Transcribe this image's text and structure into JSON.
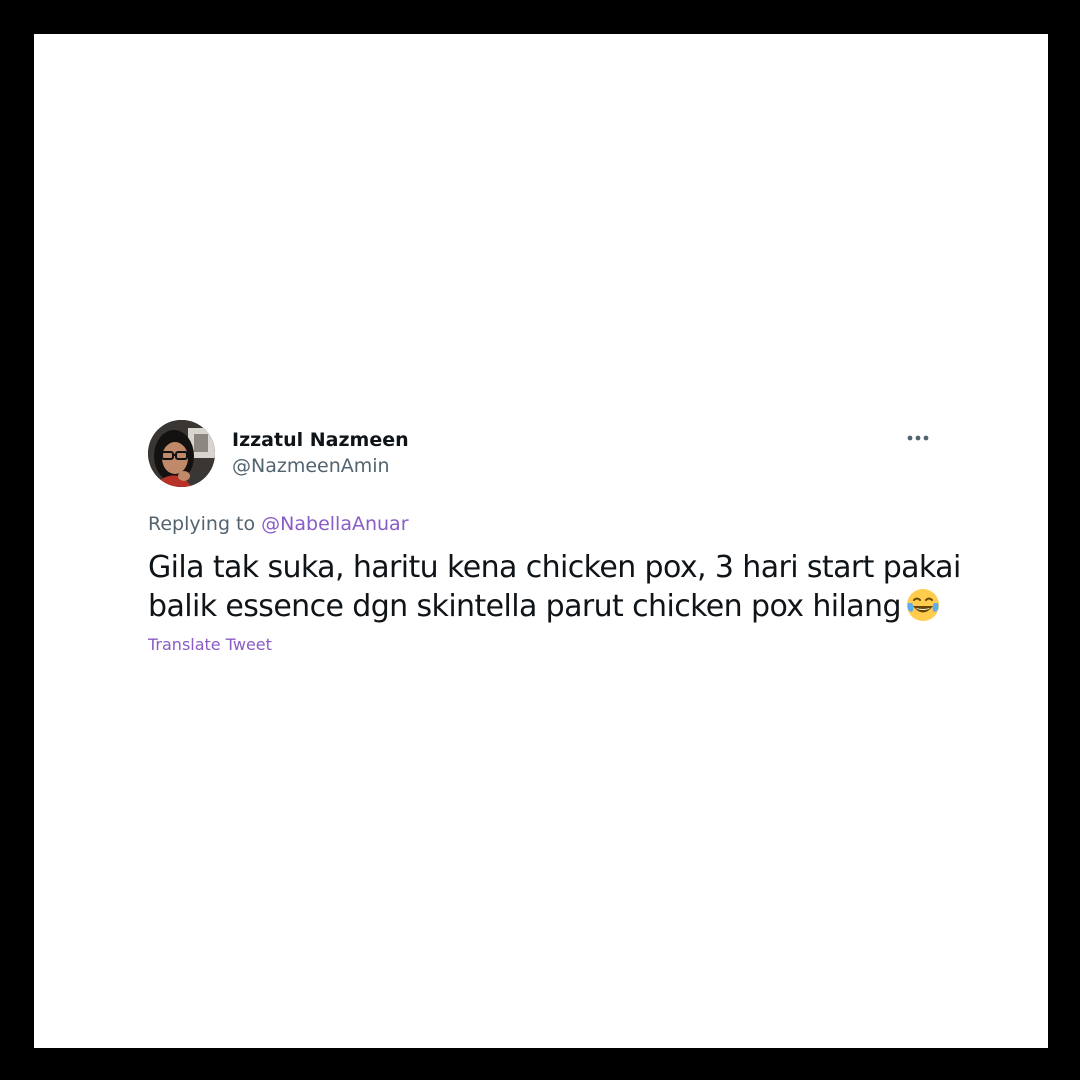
{
  "tweet": {
    "author": {
      "display_name": "Izzatul Nazmeen",
      "handle": "@NazmeenAmin"
    },
    "replying_prefix": "Replying to",
    "replying_to": "@NabellaAnuar",
    "text_line_1": "Gila tak suka, haritu kena chicken pox, 3 hari start pakai",
    "text_line_2": "balik essence dgn skintella parut chicken pox hilang",
    "emoji": "face-with-tears-of-joy",
    "translate_label": "Translate Tweet",
    "more_icon": "more-horizontal-icon"
  },
  "colors": {
    "page_border": "#000000",
    "card_background": "#ffffff",
    "primary_text": "#0f1419",
    "secondary_text": "#536471",
    "accent_link": "#8a5cc6"
  }
}
